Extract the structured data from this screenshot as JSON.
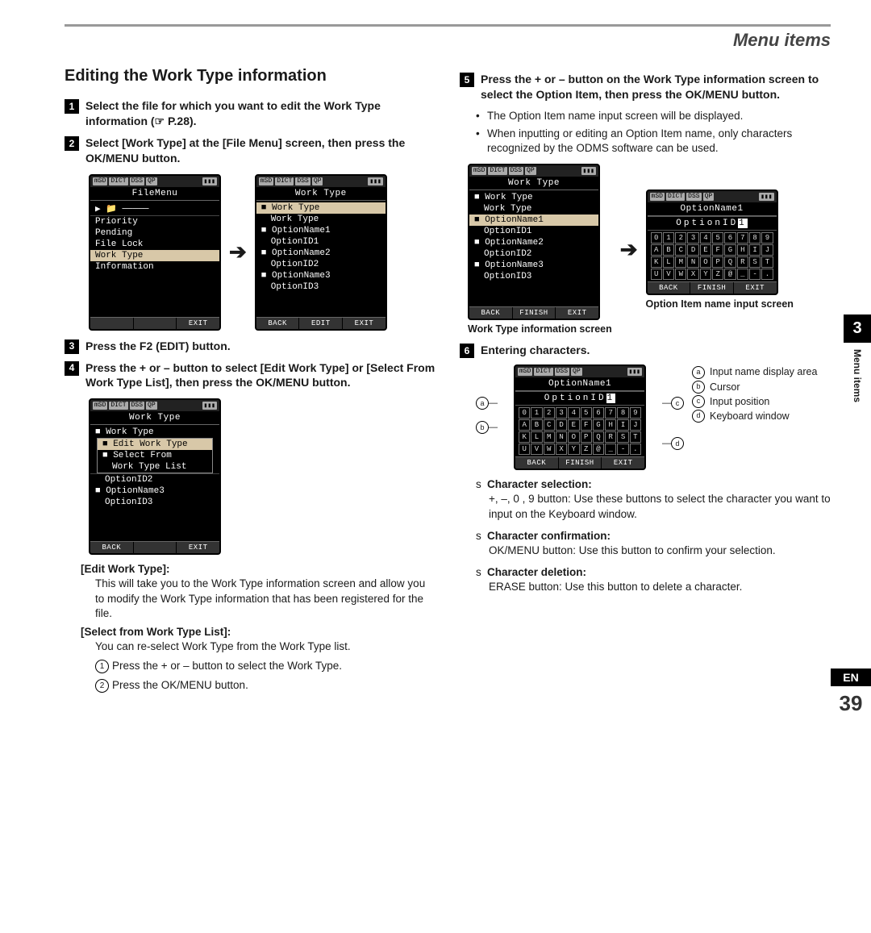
{
  "header": {
    "title": "Menu items"
  },
  "section_title": "Editing the Work Type information",
  "steps": {
    "s1": "Select the file for which you want to edit the Work Type information (☞ P.28).",
    "s2": "Select [Work Type] at the [File Menu] screen, then press the OK/MENU button.",
    "s3": "Press the F2 (EDIT) button.",
    "s4": "Press the + or – button to select [Edit Work Type] or [Select From Work Type List], then press the OK/MENU button.",
    "s5": "Press the + or – button on the Work Type information screen to select the Option Item, then press the OK/MENU button.",
    "s6": "Entering characters."
  },
  "s5_notes": [
    "The Option Item name input screen will be displayed.",
    "When inputting or editing an Option Item name, only characters recognized by the ODMS software can be used."
  ],
  "s4_sub": {
    "edit_label": "[Edit Work Type]:",
    "edit_text": "This will take you to the Work Type information screen and allow you to modify the Work Type information that has been registered for the file.",
    "select_label": "[Select from Work Type List]:",
    "select_text": "You can re-select Work Type from the Work Type list.",
    "circ1": "Press the + or – button to select the Work Type.",
    "circ2": "Press the OK/MENU button."
  },
  "lcd": {
    "status_icons": [
      "mSD",
      "DICT",
      "DSS",
      "QP"
    ],
    "filemenu": {
      "title": "FileMenu",
      "items": [
        "Priority",
        "Pending",
        "File Lock",
        "Work Type",
        "Information"
      ],
      "selected": "Work Type",
      "soft": [
        "",
        "",
        "EXIT"
      ]
    },
    "worktype": {
      "title": "Work Type",
      "groups": [
        {
          "hdr": "Work Type",
          "items": [
            "Work Type"
          ]
        },
        {
          "hdr": "OptionName1",
          "items": [
            "OptionID1"
          ]
        },
        {
          "hdr": "OptionName2",
          "items": [
            "OptionID2"
          ]
        },
        {
          "hdr": "OptionName3",
          "items": [
            "OptionID3"
          ]
        }
      ],
      "soft": [
        "BACK",
        "EDIT",
        "EXIT"
      ]
    },
    "worktype_sel": {
      "title": "Work Type",
      "selected_hdr": 1,
      "soft": [
        "BACK",
        "FINISH",
        "EXIT"
      ]
    },
    "popup": {
      "title": "Work Type",
      "pop_hdr": "Work Type",
      "options": [
        "Edit Work Type",
        "Select From",
        "Work Type List"
      ],
      "selected": 0,
      "tail": [
        "OptionID2",
        "OptionName3",
        "OptionID3"
      ],
      "soft": [
        "BACK",
        "",
        "EXIT"
      ]
    },
    "option_input": {
      "title": "OptionName1",
      "input_chars": [
        "O",
        "p",
        "t",
        "i",
        "o",
        "n",
        "I",
        "D"
      ],
      "cursor_char": "1",
      "keyboard": [
        [
          "0",
          "1",
          "2",
          "3",
          "4",
          "5",
          "6",
          "7",
          "8",
          "9"
        ],
        [
          "A",
          "B",
          "C",
          "D",
          "E",
          "F",
          "G",
          "H",
          "I",
          "J"
        ],
        [
          "K",
          "L",
          "M",
          "N",
          "O",
          "P",
          "Q",
          "R",
          "S",
          "T"
        ],
        [
          "U",
          "V",
          "W",
          "X",
          "Y",
          "Z",
          "@",
          "_",
          "-",
          "."
        ]
      ],
      "soft": [
        "BACK",
        "FINISH",
        "EXIT"
      ]
    }
  },
  "captions": {
    "left": "Work Type information screen",
    "right": "Option Item name input screen"
  },
  "callouts": {
    "a": "Input name display area",
    "b": "Cursor",
    "c": "Input position",
    "d": "Keyboard window"
  },
  "slist": {
    "cs_title": "Character selection:",
    "cs_text": "+, –, 0 , 9  button: Use these buttons to select the character you want to input on the Keyboard window.",
    "cc_title": "Character confirmation:",
    "cc_text": "OK/MENU button: Use this button to confirm your selection.",
    "cd_title": "Character deletion:",
    "cd_text": "ERASE button: Use this button to delete a character."
  },
  "side_tab": {
    "num": "3",
    "label": "Menu items"
  },
  "footer": {
    "lang": "EN",
    "page": "39"
  }
}
